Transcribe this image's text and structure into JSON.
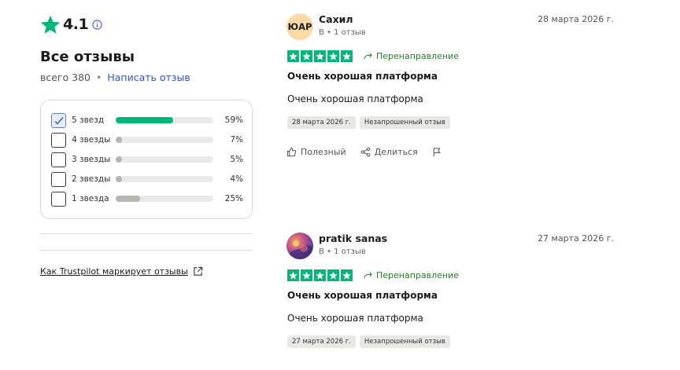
{
  "summary": {
    "rating": "4.1",
    "title": "Все отзывы",
    "total_label": "всего 380",
    "dot": "•",
    "write_review": "Написать отзыв",
    "filters": [
      {
        "label": "5 звезд",
        "pct": "59%",
        "fraction": 0.59,
        "checked": true,
        "color": "#00b67a"
      },
      {
        "label": "4 звезды",
        "pct": "7%",
        "fraction": 0.07,
        "checked": false,
        "color": "#b8b6b0"
      },
      {
        "label": "3 звезды",
        "pct": "5%",
        "fraction": 0.05,
        "checked": false,
        "color": "#b8b6b0"
      },
      {
        "label": "2 звезды",
        "pct": "4%",
        "fraction": 0.04,
        "checked": false,
        "color": "#b8b6b0"
      },
      {
        "label": "1 звезда",
        "pct": "25%",
        "fraction": 0.25,
        "checked": false,
        "color": "#b8b6b0"
      }
    ],
    "how_link": "Как Trustpilot маркирует отзывы"
  },
  "reviews": [
    {
      "avatar_text": "ЮАР",
      "avatar_color": "#fcd9a6",
      "name": "Сахил",
      "meta": "В • 1 отзыв",
      "date": "28 марта 2026 г.",
      "stars": 5,
      "redirect": "Перенаправление",
      "title": "Очень хорошая платформа",
      "body": "Очень хорошая платформа",
      "chip_date": "28 марта 2026 г.",
      "chip_type": "Незапрошенный отзыв",
      "useful": "Полезный",
      "share": "Делиться"
    },
    {
      "avatar_text": "",
      "avatar_color": "#7a4fa3",
      "name": "pratik sanas",
      "meta": "В • 1 отзыв",
      "date": "27 марта 2026 г.",
      "stars": 5,
      "redirect": "Перенаправление",
      "title": "Очень хорошая платформа",
      "body": "Очень хорошая платформа",
      "chip_date": "27 марта 2026 г.",
      "chip_type": "Незапрошенный отзыв"
    }
  ],
  "colors": {
    "star_green": "#00b67a",
    "link_blue": "#2f56c9",
    "redirect_green": "#2a7a2a"
  }
}
